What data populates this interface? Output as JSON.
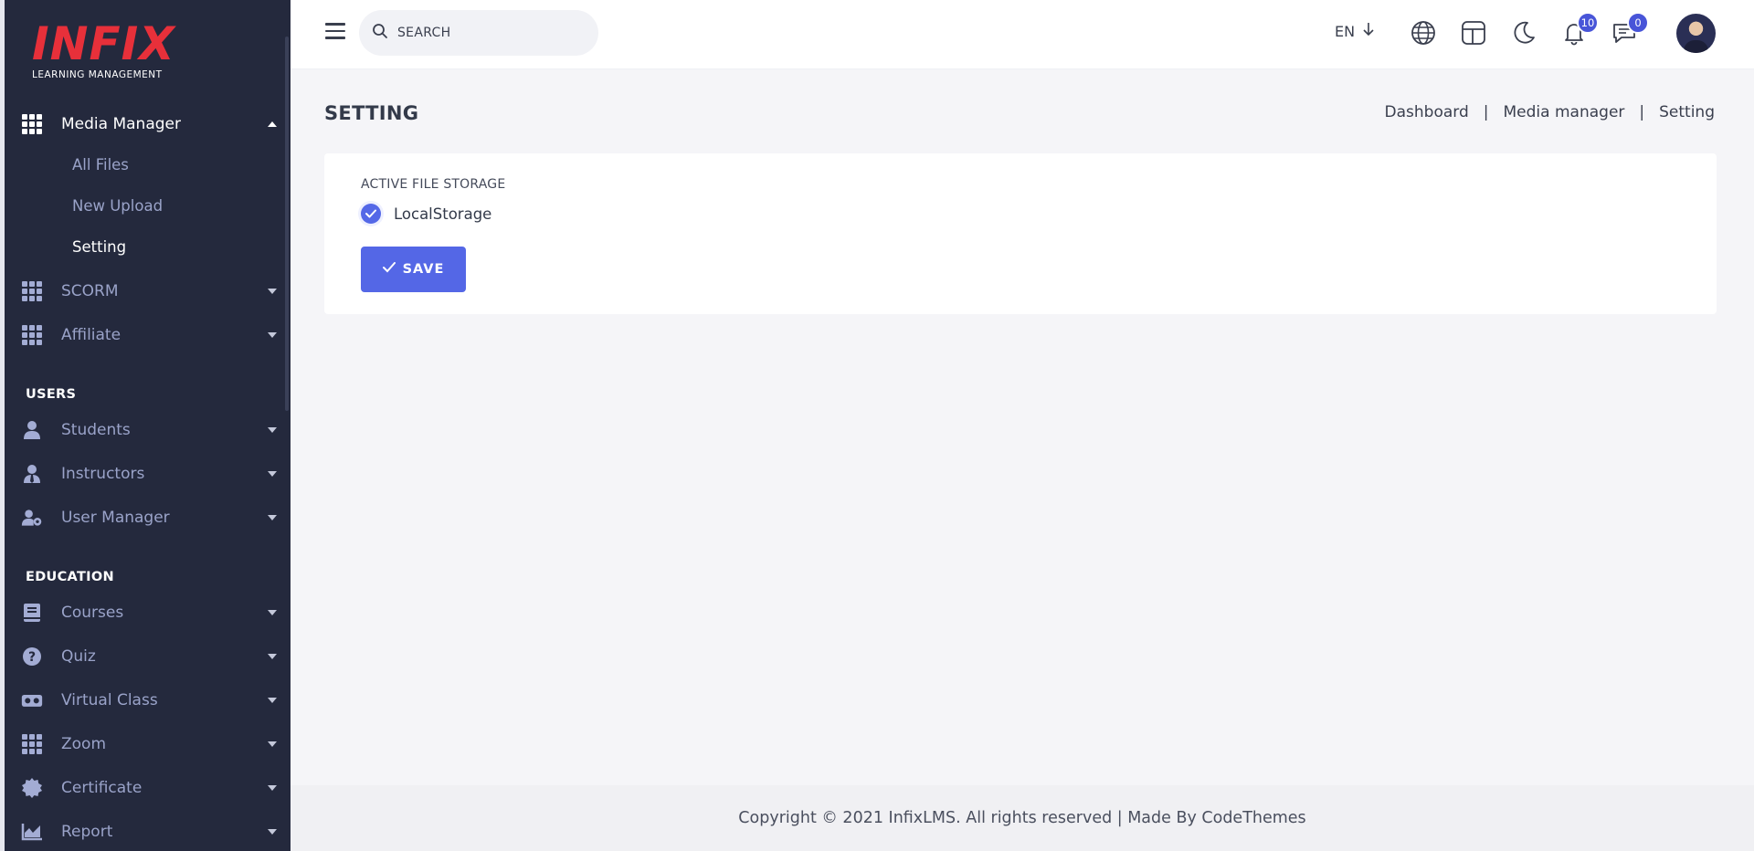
{
  "sidebar": {
    "logo": {
      "word": "INFIX",
      "subtitle": "LEARNING MANAGEMENT"
    },
    "media_manager": {
      "label": "Media Manager",
      "sub_items": [
        "All Files",
        "New Upload",
        "Setting"
      ]
    },
    "items_top": [
      {
        "label": "SCORM",
        "icon": "grid-icon"
      },
      {
        "label": "Affiliate",
        "icon": "grid-icon"
      }
    ],
    "sections": [
      {
        "title": "USERS",
        "items": [
          {
            "label": "Students",
            "icon": "user-icon"
          },
          {
            "label": "Instructors",
            "icon": "instructor-icon"
          },
          {
            "label": "User Manager",
            "icon": "user-cog-icon"
          }
        ]
      },
      {
        "title": "EDUCATION",
        "items": [
          {
            "label": "Courses",
            "icon": "book-icon"
          },
          {
            "label": "Quiz",
            "icon": "question-icon"
          },
          {
            "label": "Virtual Class",
            "icon": "vr-icon"
          },
          {
            "label": "Zoom",
            "icon": "grid-icon"
          },
          {
            "label": "Certificate",
            "icon": "certificate-icon"
          },
          {
            "label": "Report",
            "icon": "chart-icon"
          }
        ]
      }
    ]
  },
  "header": {
    "search_placeholder": "SEARCH",
    "language": "EN",
    "notifications_count": "10",
    "messages_count": "0"
  },
  "main": {
    "title": "SETTING",
    "breadcrumb": [
      "Dashboard",
      "Media manager",
      "Setting"
    ],
    "form": {
      "label": "ACTIVE FILE STORAGE",
      "option": "LocalStorage",
      "save_label": "SAVE"
    }
  },
  "footer": {
    "text": "Copyright © 2021 InfixLMS. All rights reserved | Made By CodeThemes"
  },
  "colors": {
    "sidebar_bg": "#24293d",
    "accent": "#5467e6",
    "logo_red": "#e7303a",
    "main_bg": "#f5f5f8"
  }
}
